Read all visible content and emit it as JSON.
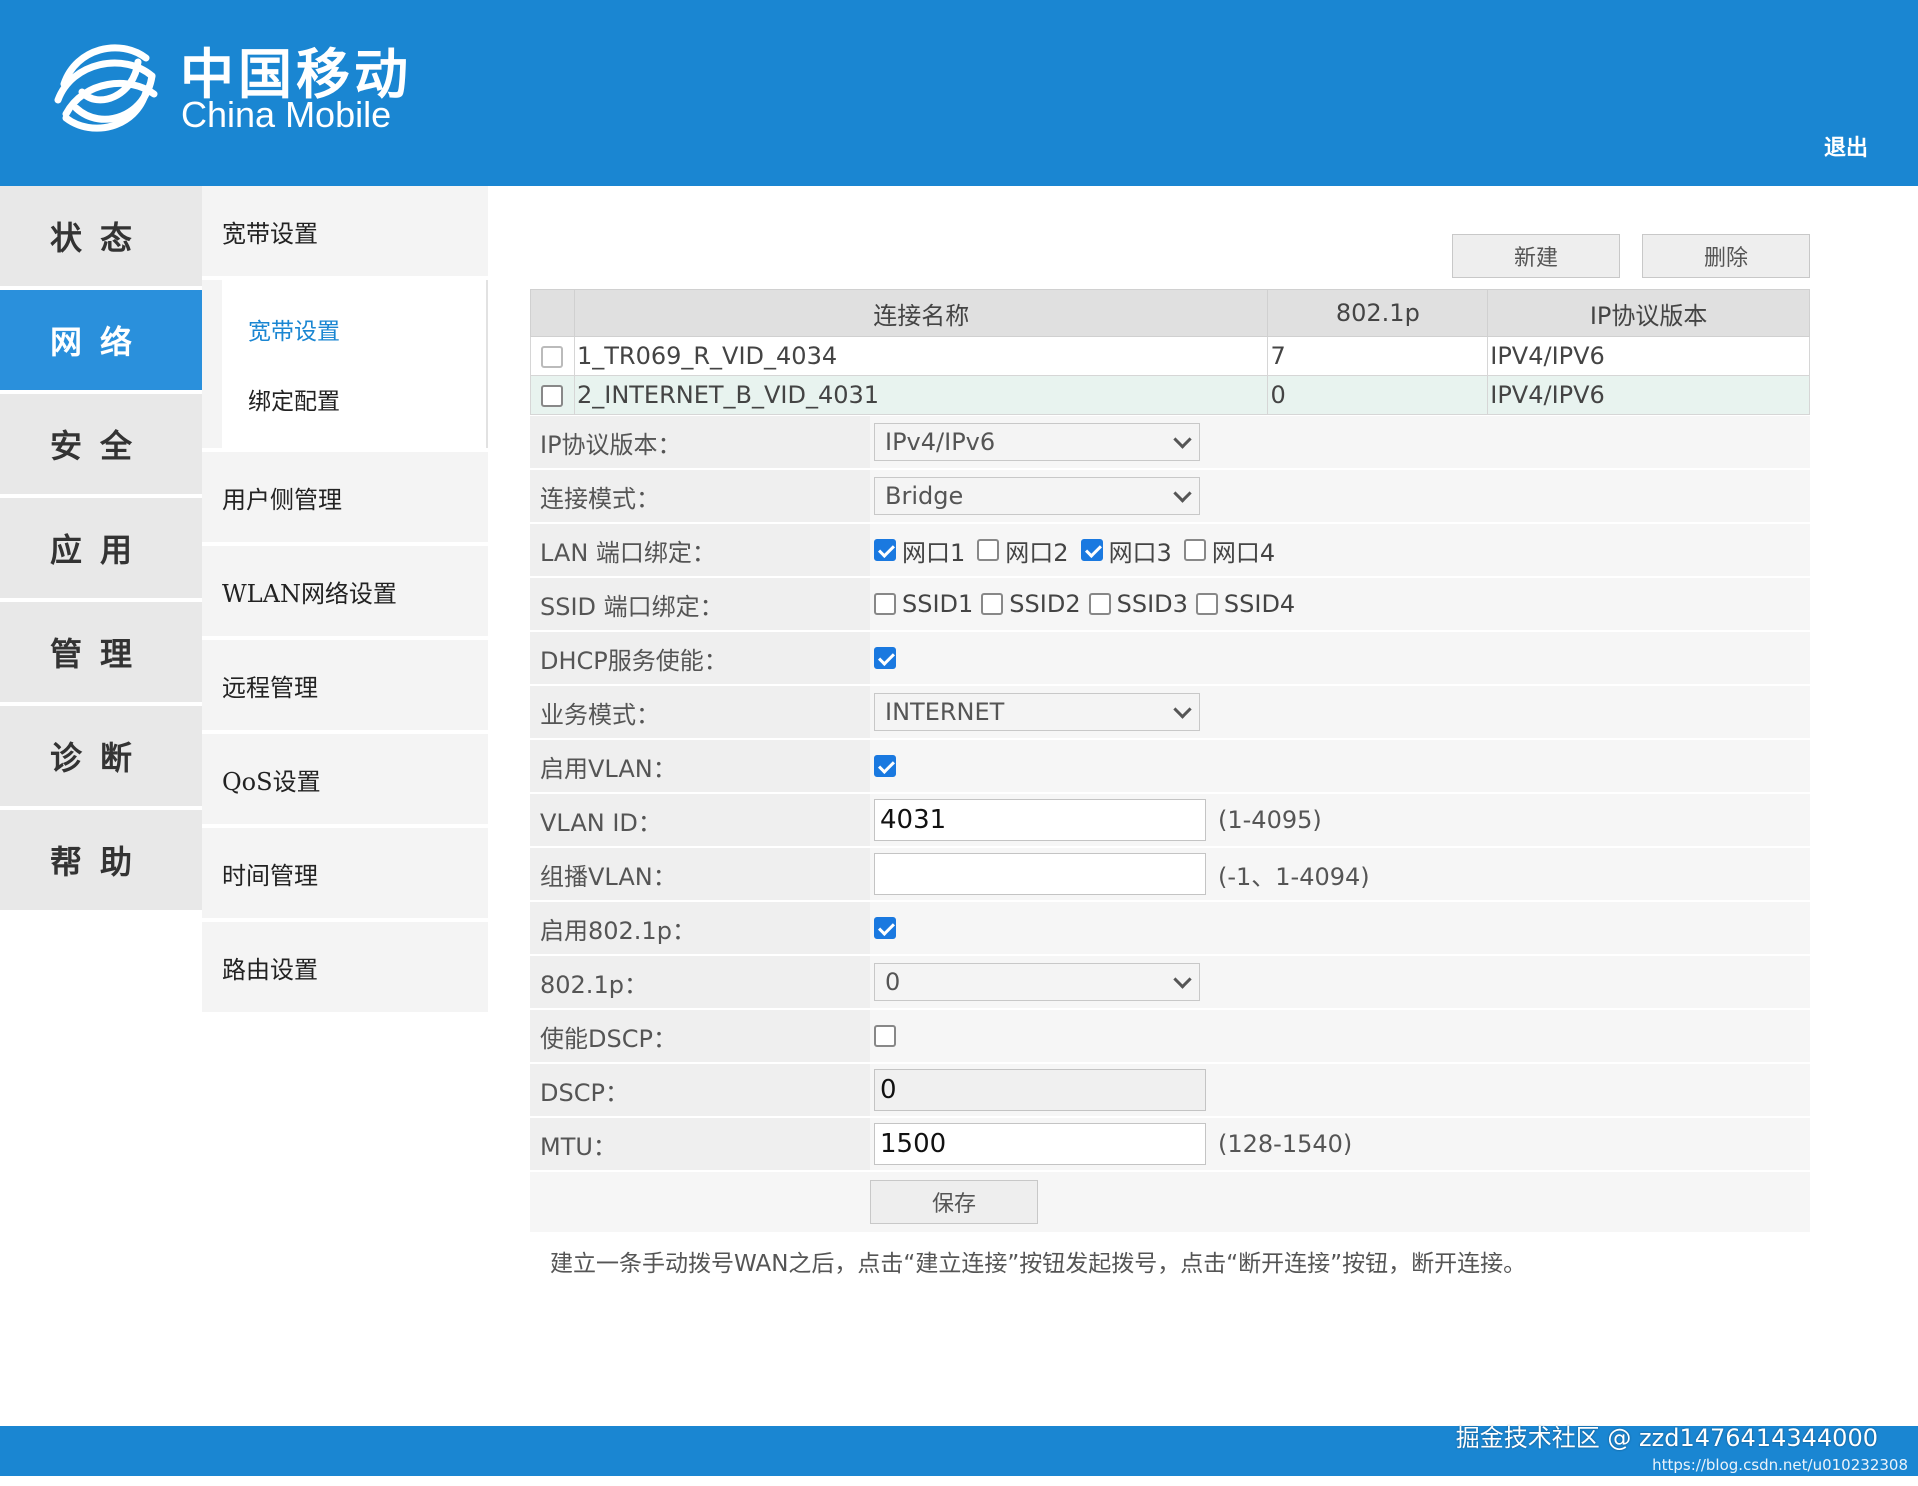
{
  "header": {
    "logo_cn": "中国移动",
    "logo_en": "China Mobile",
    "logout": "退出",
    "bg_color": "#1a86d2"
  },
  "main_nav": [
    {
      "label": "状态",
      "active": false
    },
    {
      "label": "网络",
      "active": true
    },
    {
      "label": "安全",
      "active": false
    },
    {
      "label": "应用",
      "active": false
    },
    {
      "label": "管理",
      "active": false
    },
    {
      "label": "诊断",
      "active": false
    },
    {
      "label": "帮助",
      "active": false
    }
  ],
  "sub_nav": {
    "broadband": "宽带设置",
    "broadband_children": [
      {
        "label": "宽带设置",
        "active": true
      },
      {
        "label": "绑定配置",
        "active": false
      }
    ],
    "items": [
      "用户侧管理",
      "WLAN网络设置",
      "远程管理",
      "QoS设置",
      "时间管理",
      "路由设置"
    ]
  },
  "buttons": {
    "new": "新建",
    "delete": "删除",
    "save": "保存"
  },
  "connections": {
    "headers": [
      "连接名称",
      "802.1p",
      "IP协议版本"
    ],
    "rows": [
      {
        "name": "1_TR069_R_VID_4034",
        "p8021": "7",
        "ipver": "IPV4/IPV6",
        "checked": false,
        "selected": false
      },
      {
        "name": "2_INTERNET_B_VID_4031",
        "p8021": "0",
        "ipver": "IPV4/IPV6",
        "checked": false,
        "selected": true
      }
    ]
  },
  "form": {
    "ip_version": {
      "label": "IP协议版本：",
      "value": "IPv4/IPv6"
    },
    "conn_mode": {
      "label": "连接模式：",
      "value": "Bridge"
    },
    "lan_bind": {
      "label": "LAN 端口绑定：",
      "ports": [
        {
          "label": "网口1",
          "checked": true
        },
        {
          "label": "网口2",
          "checked": false
        },
        {
          "label": "网口3",
          "checked": true
        },
        {
          "label": "网口4",
          "checked": false
        }
      ]
    },
    "ssid_bind": {
      "label": "SSID 端口绑定：",
      "ssids": [
        {
          "label": "SSID1",
          "checked": false
        },
        {
          "label": "SSID2",
          "checked": false
        },
        {
          "label": "SSID3",
          "checked": false
        },
        {
          "label": "SSID4",
          "checked": false
        }
      ]
    },
    "dhcp": {
      "label": "DHCP服务使能：",
      "checked": true
    },
    "service_mode": {
      "label": "业务模式：",
      "value": "INTERNET"
    },
    "enable_vlan": {
      "label": "启用VLAN：",
      "checked": true
    },
    "vlan_id": {
      "label": "VLAN ID：",
      "value": "4031",
      "hint": "(1-4095)"
    },
    "mcast_vlan": {
      "label": "组播VLAN：",
      "value": "",
      "hint": "(-1、1-4094)"
    },
    "enable_8021p": {
      "label": "启用802.1p：",
      "checked": true
    },
    "p8021": {
      "label": "802.1p：",
      "value": "0"
    },
    "enable_dscp": {
      "label": "使能DSCP：",
      "checked": false
    },
    "dscp": {
      "label": "DSCP：",
      "value": "0"
    },
    "mtu": {
      "label": "MTU：",
      "value": "1500",
      "hint": "(128-1540)"
    }
  },
  "note": "建立一条手动拨号WAN之后，点击“建立连接”按钮发起拨号，点击“断开连接”按钮，断开连接。",
  "watermark": {
    "line1": "掘金技术社区 @ zzd1476414344000",
    "line2": "https://blog.csdn.net/u010232308"
  }
}
